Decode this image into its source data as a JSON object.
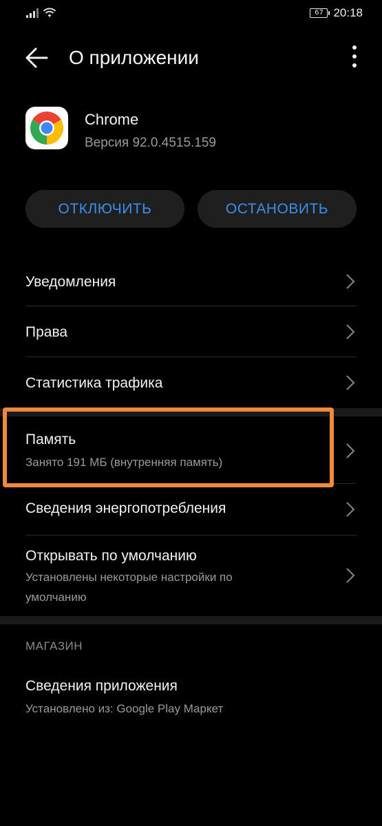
{
  "status_bar": {
    "battery": "67",
    "time": "20:18",
    "icons": [
      "signal-icon",
      "wifi-icon",
      "battery-icon"
    ]
  },
  "header": {
    "title": "О приложении",
    "icons": [
      "back-arrow-icon",
      "more-vert-icon"
    ]
  },
  "app": {
    "name": "Chrome",
    "version": "Версия 92.0.4515.159",
    "icon": "chrome-logo-icon"
  },
  "actions": {
    "disable_label": "ОТКЛЮЧИТЬ",
    "stop_label": "ОСТАНОВИТЬ"
  },
  "settings": {
    "notifications": "Уведомления",
    "permissions": "Права",
    "data_usage": "Статистика трафика",
    "storage": {
      "title": "Память",
      "subtitle": "Занято 191 МБ (внутренняя память)"
    },
    "battery": "Сведения энергопотребления",
    "open_by_default": {
      "title": "Открывать по умолчанию",
      "subtitle": "Установлены некоторые настройки по умолчанию"
    }
  },
  "store": {
    "header": "МАГАЗИН",
    "app_details": {
      "title": "Сведения приложения",
      "subtitle": "Установлено из: Google Play Маркет"
    }
  },
  "colors": {
    "accent": "#3b8ff0",
    "highlight": "#ef8a3c",
    "background": "#000000"
  }
}
